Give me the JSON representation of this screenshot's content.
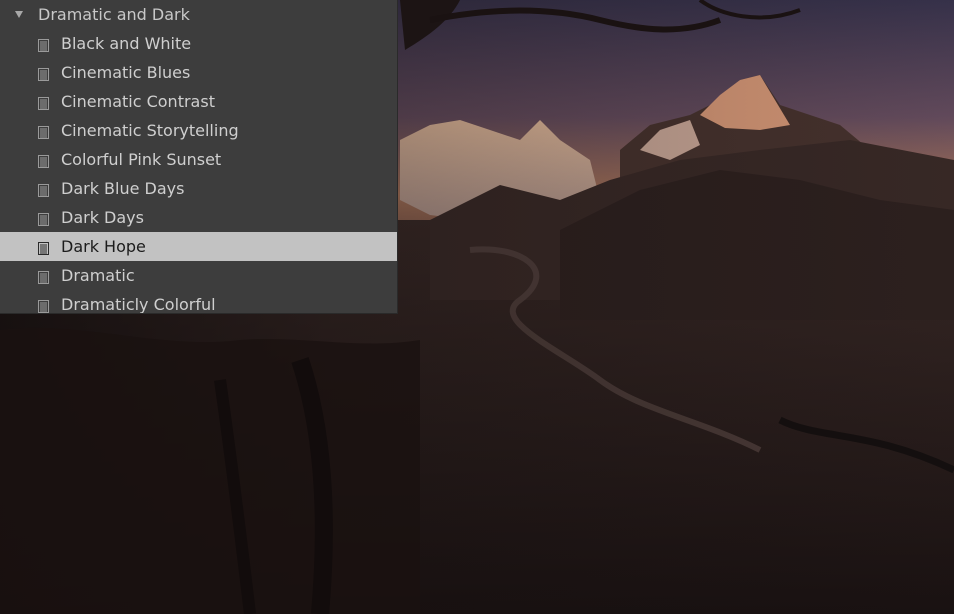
{
  "panel": {
    "group_label": "Dramatic and Dark",
    "group_expanded": true,
    "presets": [
      {
        "label": "Black and White",
        "selected": false
      },
      {
        "label": "Cinematic Blues",
        "selected": false
      },
      {
        "label": "Cinematic Contrast",
        "selected": false
      },
      {
        "label": "Cinematic Storytelling",
        "selected": false
      },
      {
        "label": "Colorful Pink Sunset",
        "selected": false
      },
      {
        "label": "Dark Blue Days",
        "selected": false
      },
      {
        "label": "Dark Days",
        "selected": false
      },
      {
        "label": "Dark Hope",
        "selected": true
      },
      {
        "label": "Dramatic",
        "selected": false
      },
      {
        "label": "Dramaticly Colorful",
        "selected": false
      }
    ]
  },
  "colors": {
    "panel_bg": "#3d3d3d",
    "selected_bg": "#c2c2c2",
    "text": "#cfcfcf",
    "selected_text": "#1c1c1c"
  },
  "icons": {
    "group_toggle": "triangle-down-icon",
    "preset": "preset-document-icon"
  }
}
